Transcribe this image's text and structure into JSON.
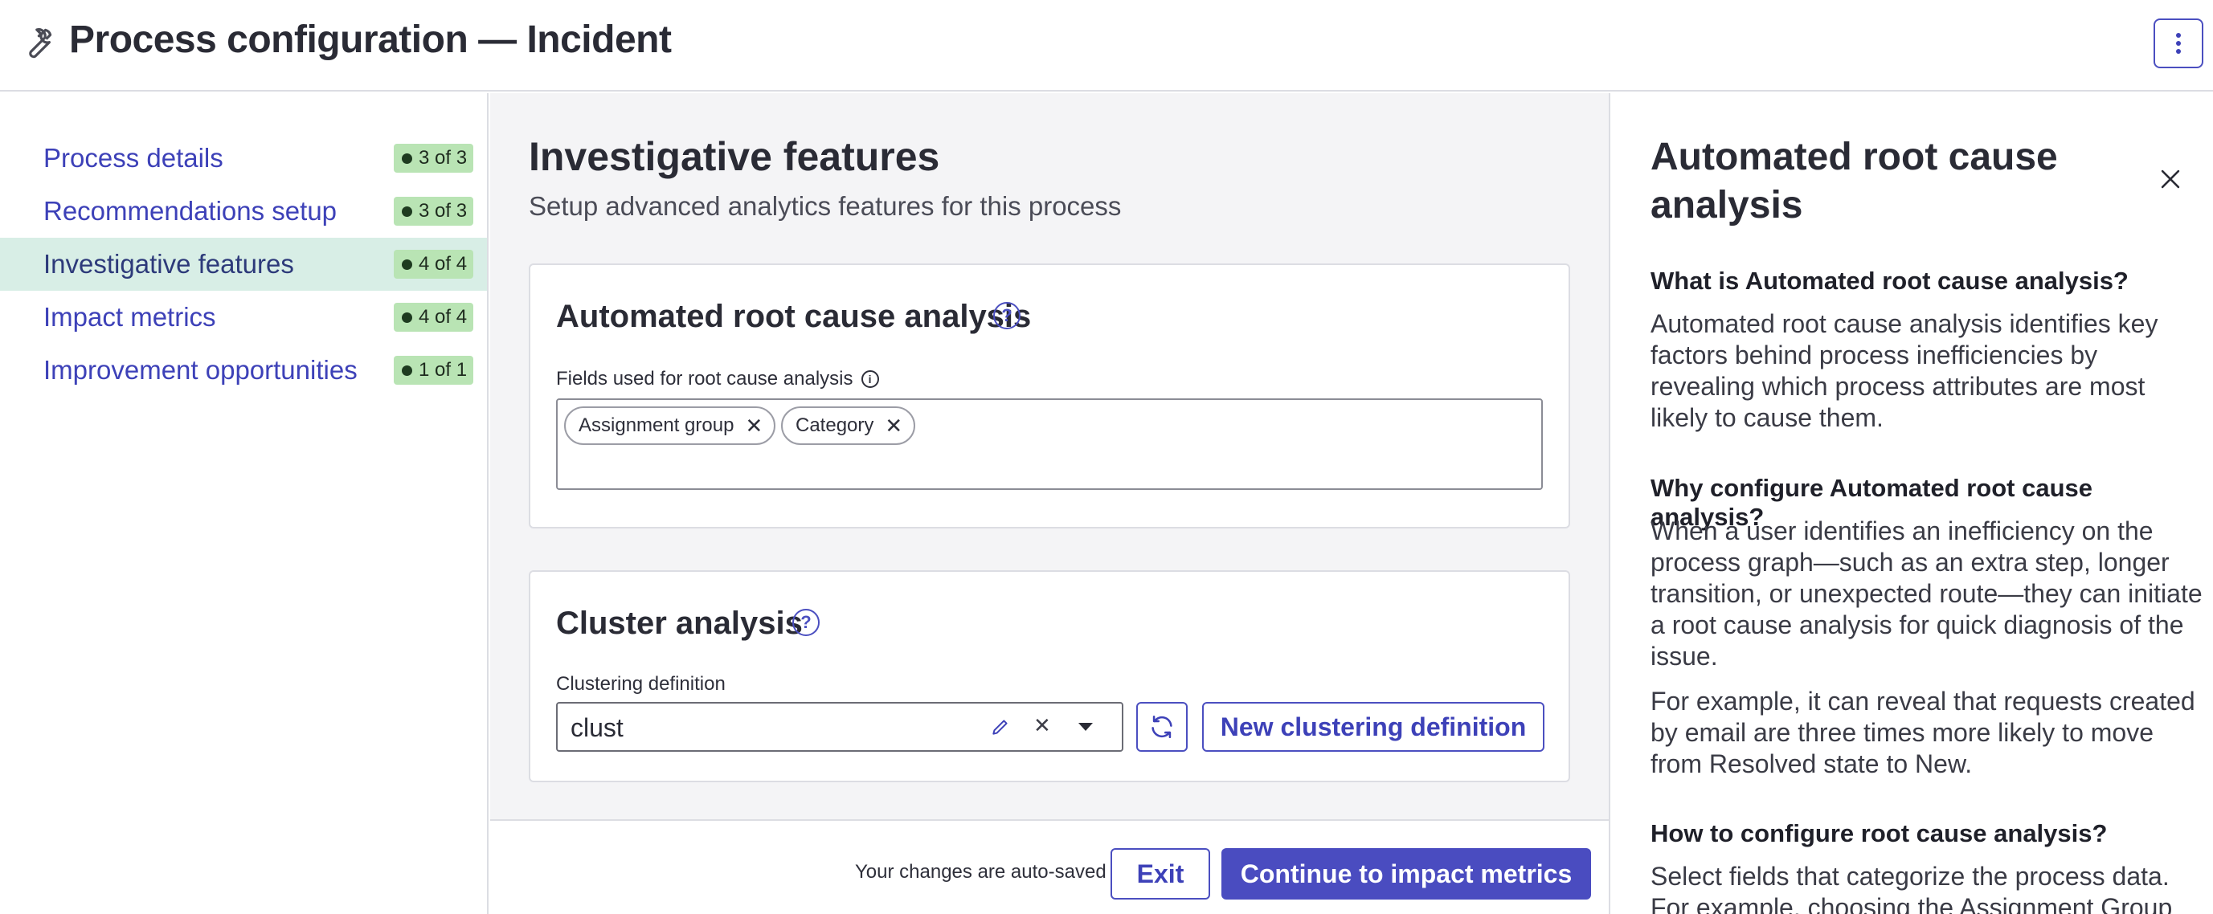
{
  "header": {
    "title": "Process configuration — Incident"
  },
  "nav": {
    "items": [
      {
        "label": "Process details",
        "badge": "3 of 3"
      },
      {
        "label": "Recommendations setup",
        "badge": "3 of 3"
      },
      {
        "label": "Investigative features",
        "badge": "4 of 4"
      },
      {
        "label": "Impact metrics",
        "badge": "4 of 4"
      },
      {
        "label": "Improvement opportunities",
        "badge": "1 of 1"
      }
    ]
  },
  "main": {
    "title": "Investigative features",
    "subtitle": "Setup advanced analytics features for this process",
    "rca": {
      "title": "Automated root cause analysis",
      "field_label": "Fields used for root cause analysis",
      "tags": [
        "Assignment group",
        "Category"
      ]
    },
    "cluster": {
      "title": "Cluster analysis",
      "field_label": "Clustering definition",
      "value": "clust",
      "new_button": "New clustering definition"
    }
  },
  "footer": {
    "autosave": "Your changes are auto-saved",
    "exit": "Exit",
    "continue": "Continue to impact metrics"
  },
  "panel": {
    "title": "Automated root cause analysis",
    "sections": [
      {
        "heading": "What is Automated root cause analysis?",
        "paragraphs": [
          "Automated root cause analysis identifies key factors behind process inefficiencies by revealing which process attributes are most likely to cause them."
        ]
      },
      {
        "heading": "Why configure Automated root cause analysis?",
        "paragraphs": [
          "When a user identifies an inefficiency on the process graph—such as an extra step, longer transition, or unexpected route—they can initiate a root cause analysis for quick diagnosis of the issue.",
          "For example, it can reveal that requests created by email are three times more likely to move from Resolved state to New."
        ]
      },
      {
        "heading": "How to configure root cause analysis?",
        "paragraphs": [
          "Select fields that categorize the process data. For example, choosing the Assignment Group"
        ]
      }
    ]
  },
  "colors": {
    "accent": "#4a4cc0",
    "active_nav": "#d8eee6",
    "badge": "#b9e4b4"
  }
}
